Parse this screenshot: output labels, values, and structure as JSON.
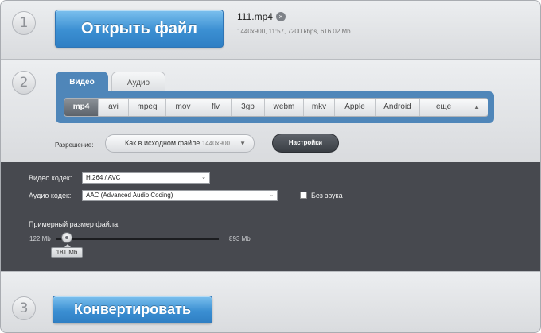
{
  "step1": {
    "number": "1",
    "open_button": "Открыть файл",
    "file_name": "111.mp4",
    "file_remove_icon": "×",
    "file_meta": "1440x900, 11:57, 7200 kbps, 616.02 Mb"
  },
  "step2": {
    "number": "2",
    "tabs": [
      "Видео",
      "Аудио"
    ],
    "formats": [
      "mp4",
      "avi",
      "mpeg",
      "mov",
      "flv",
      "3gp",
      "webm",
      "mkv",
      "Apple",
      "Android",
      "еще"
    ],
    "active_format": "mp4",
    "resolution_label": "Разрешение:",
    "resolution_value": "Как в исходном файле",
    "resolution_dim": "1440x900",
    "settings_button": "Настройки"
  },
  "settings": {
    "video_codec_label": "Видео кодек:",
    "video_codec_value": "H.264 / AVC",
    "audio_codec_label": "Аудио кодек:",
    "audio_codec_value": "AAC (Advanced Audio Coding)",
    "mute_label": "Без звука",
    "mute_checked": false,
    "size_label": "Примерный размер файла:",
    "size_min": "122 Mb",
    "size_max": "893 Mb",
    "size_current": "181 Mb",
    "size_value_mb": 181
  },
  "step3": {
    "number": "3",
    "convert_button": "Конвертировать"
  },
  "colors": {
    "accent_blue": "#3b8fd2",
    "tab_blue": "#4f86b9",
    "dark_panel": "#47494f"
  }
}
